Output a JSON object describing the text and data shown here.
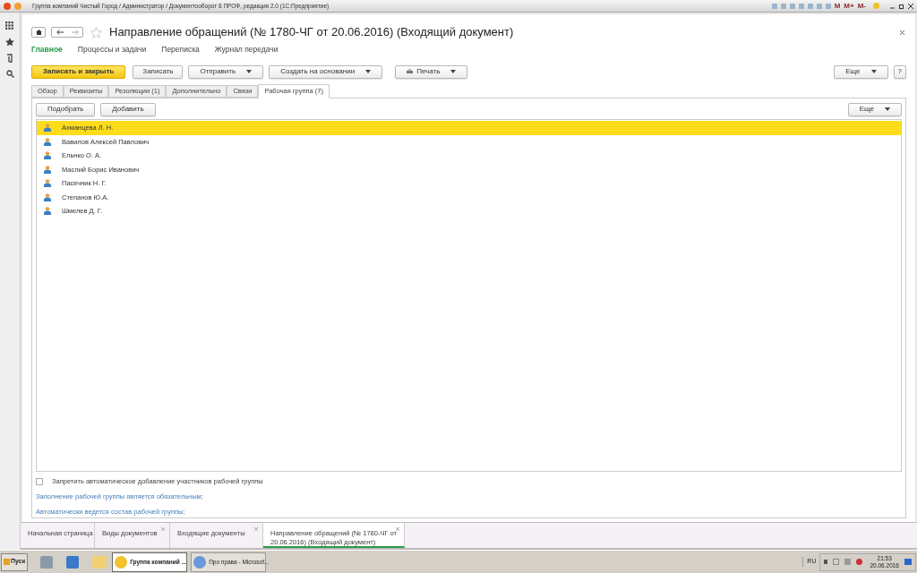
{
  "window": {
    "title": "Группа компаний Чистый Город / Администратор / Документооборот 8 ПРОФ, редакция 2.0  (1С:Предприятие)",
    "memory_buttons": [
      "M",
      "M+",
      "M-"
    ]
  },
  "document": {
    "title": "Направление обращений (№ 1780-ЧГ от 20.06.2016) (Входящий документ)"
  },
  "nav": [
    {
      "label": "Главное",
      "selected": true
    },
    {
      "label": "Процессы и задачи",
      "selected": false
    },
    {
      "label": "Переписка",
      "selected": false
    },
    {
      "label": "Журнал передачи",
      "selected": false
    }
  ],
  "actions": [
    {
      "label": "Записать и закрыть",
      "kind": "primary"
    },
    {
      "label": "Записать",
      "kind": "plain"
    },
    {
      "label": "Отправить",
      "kind": "dropdown"
    },
    {
      "label": "Создать на основании",
      "kind": "dropdown"
    },
    {
      "label": "Печать",
      "kind": "print"
    }
  ],
  "more": "Еще",
  "help": "?",
  "tabs": [
    {
      "label": "Обзор",
      "selected": false
    },
    {
      "label": "Реквизиты",
      "selected": false
    },
    {
      "label": "Резолюции (1)",
      "selected": false
    },
    {
      "label": "Дополнительно",
      "selected": false
    },
    {
      "label": "Связи",
      "selected": false
    },
    {
      "label": "Рабочая группа (7)",
      "selected": true
    }
  ],
  "group_buttons": [
    "Подобрать",
    "Добавить"
  ],
  "group_more": "Еще",
  "members": [
    {
      "name": "Ахманцева Л. Н.",
      "selected": true
    },
    {
      "name": "Вавилов Алексей Павлович",
      "selected": false
    },
    {
      "name": "Ельнко О. А.",
      "selected": false
    },
    {
      "name": "Маслий Борис Иванович",
      "selected": false
    },
    {
      "name": "Пасечник Н. Г.",
      "selected": false
    },
    {
      "name": "Степанов Ю.А.",
      "selected": false
    },
    {
      "name": "Шмелев Д. Г.",
      "selected": false
    }
  ],
  "checkbox": {
    "label": "Запретить автоматическое добавление участников рабочей группы",
    "checked": false
  },
  "notes": [
    "Заполнение рабочей группы является обязательным;",
    "Автоматически ведется состав рабочей группы;"
  ],
  "open_tabs": [
    {
      "label": "Начальная страница",
      "selected": false,
      "closable": false
    },
    {
      "label": "Виды документов",
      "selected": false,
      "closable": true
    },
    {
      "label": "Входящие документы",
      "selected": false,
      "closable": true
    },
    {
      "label": "Направление обращений (№ 1780-ЧГ от 20.06.2016) (Входящий документ)",
      "selected": true,
      "closable": true
    }
  ],
  "taskbar": {
    "start": "Пуск",
    "tasks": [
      {
        "label": "Группа компаний ...",
        "selected": true
      },
      {
        "label": "Про права - Microsof...",
        "selected": false
      }
    ],
    "language": "RU",
    "time": "21:53",
    "date": "20.06.2016"
  }
}
